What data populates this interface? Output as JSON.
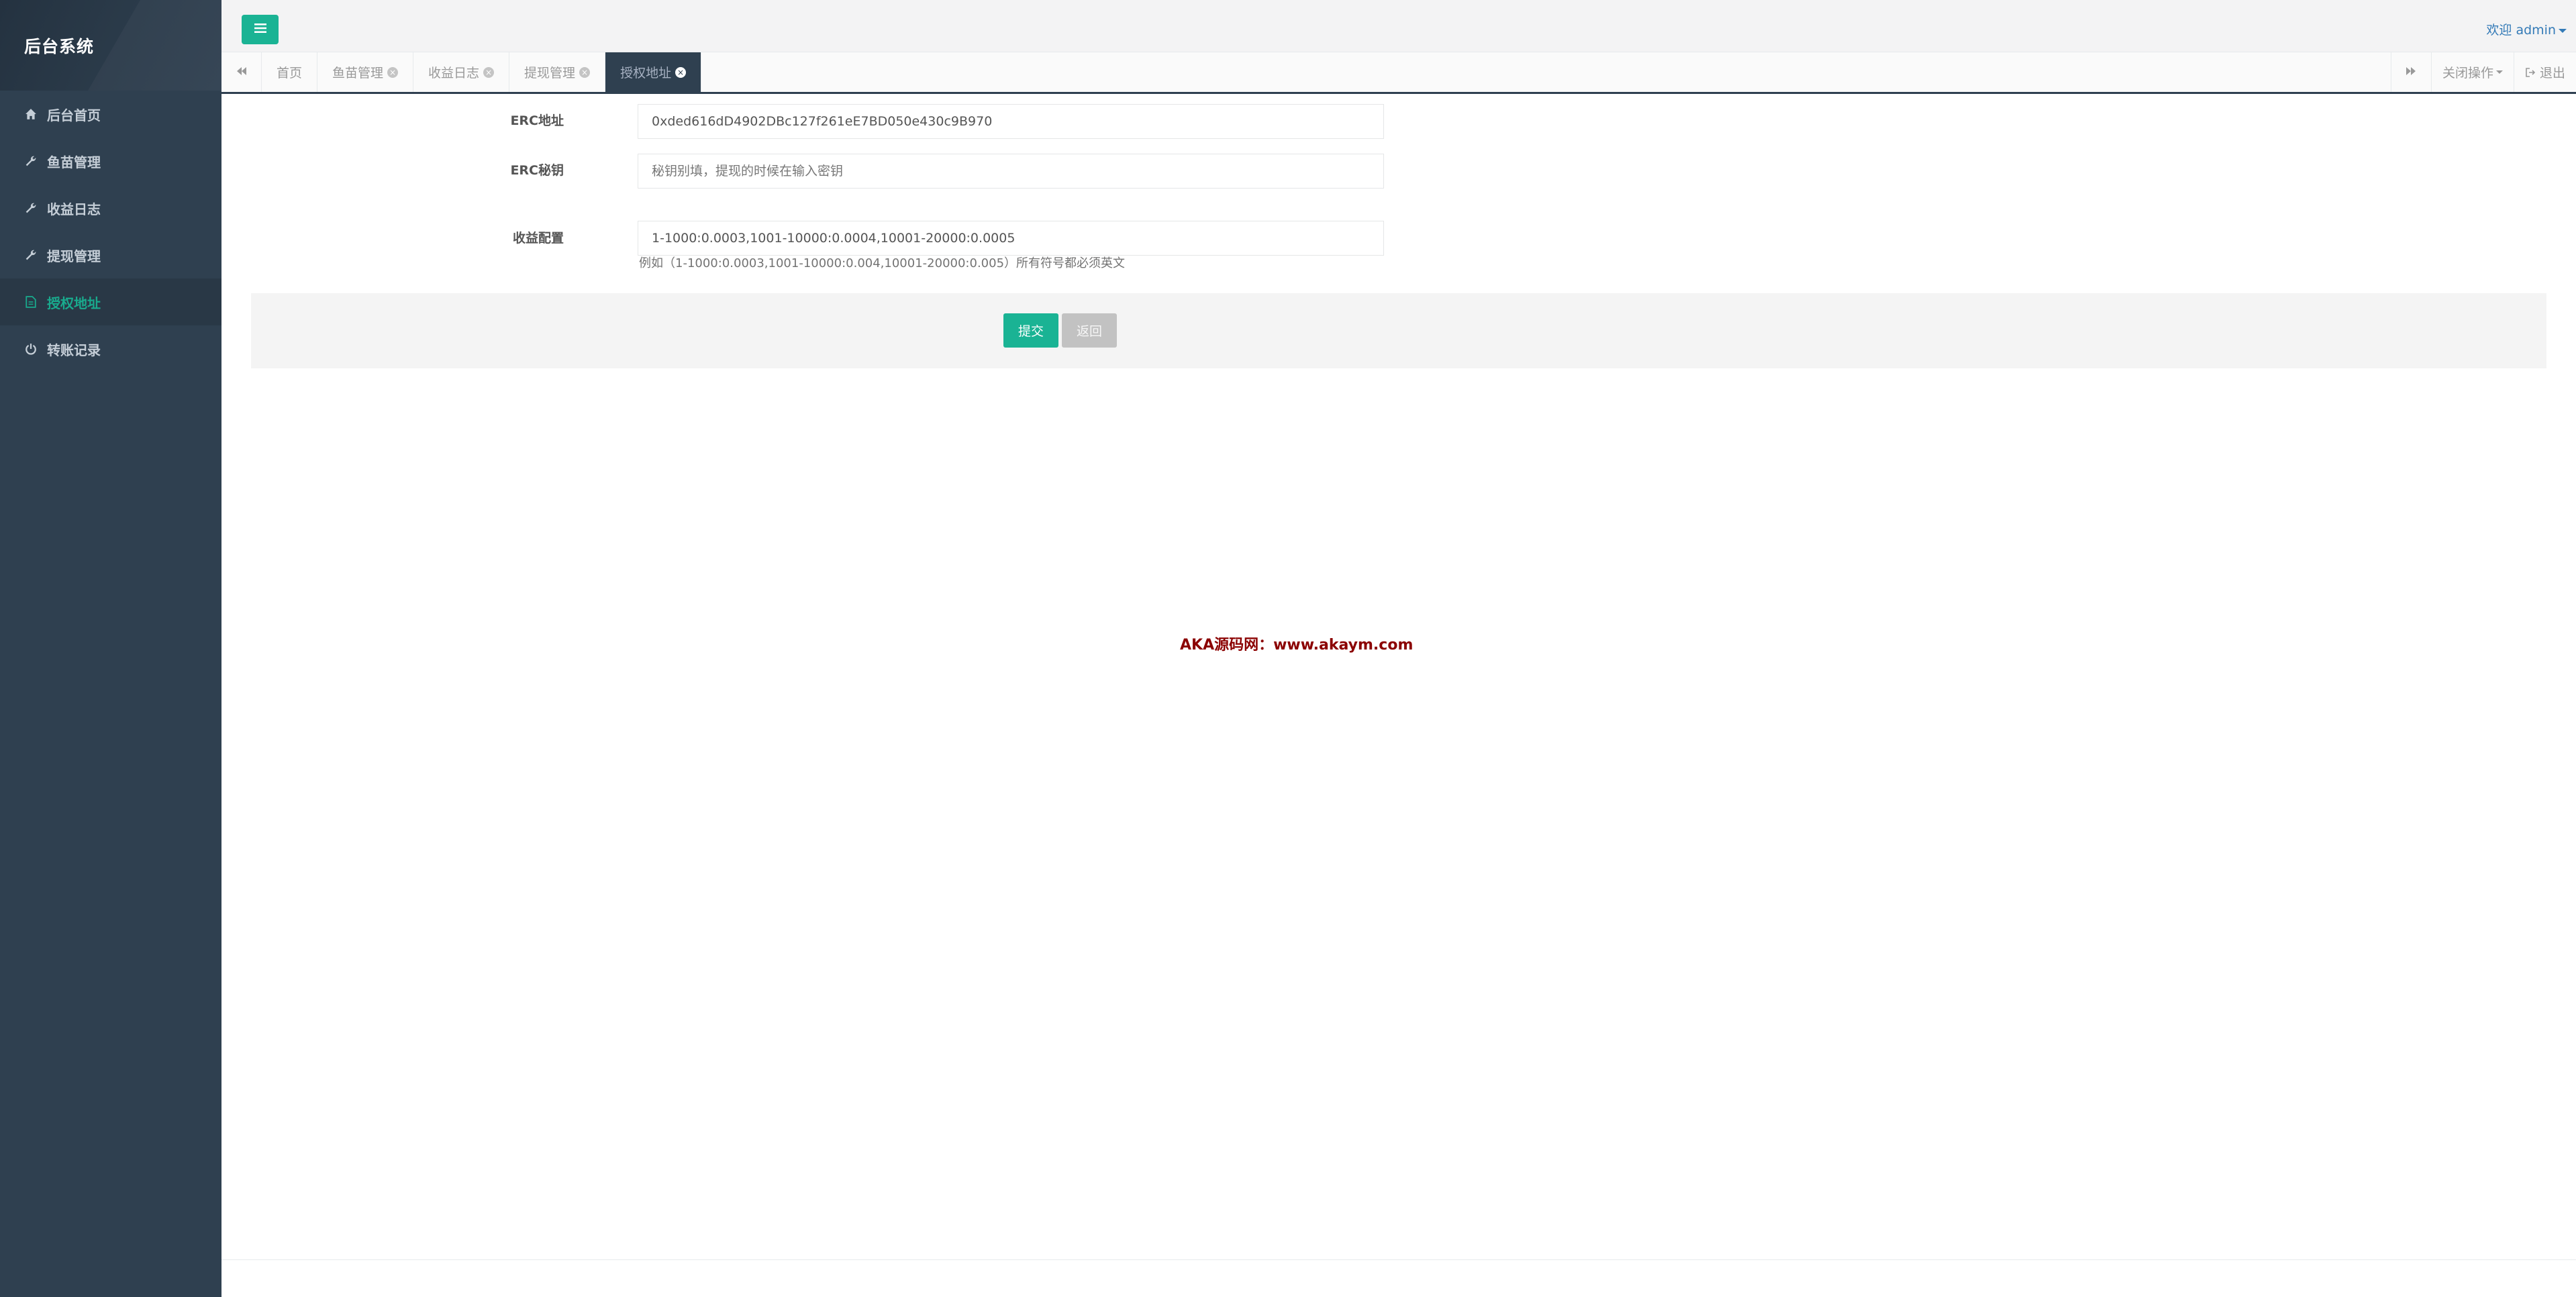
{
  "app": {
    "title": "后台系统"
  },
  "sidebar": {
    "items": [
      {
        "label": "后台首页",
        "icon": "home-icon"
      },
      {
        "label": "鱼苗管理",
        "icon": "wrench-icon"
      },
      {
        "label": "收益日志",
        "icon": "wrench-icon"
      },
      {
        "label": "提现管理",
        "icon": "wrench-icon"
      },
      {
        "label": "授权地址",
        "icon": "file-icon",
        "active": true
      },
      {
        "label": "转账记录",
        "icon": "power-icon"
      }
    ]
  },
  "header": {
    "welcome": "欢迎 admin"
  },
  "tabs": {
    "items": [
      {
        "label": "首页",
        "closable": false
      },
      {
        "label": "鱼苗管理",
        "closable": true
      },
      {
        "label": "收益日志",
        "closable": true
      },
      {
        "label": "提现管理",
        "closable": true
      },
      {
        "label": "授权地址",
        "closable": true,
        "active": true
      }
    ],
    "close_ops": "关闭操作",
    "logout": "退出"
  },
  "form": {
    "erc_address": {
      "label": "ERC地址",
      "value": "0xded616dD4902DBc127f261eE7BD050e430c9B970"
    },
    "erc_secret": {
      "label": "ERC秘钥",
      "placeholder": "秘钥别填，提现的时候在输入密钥",
      "value": ""
    },
    "income_config": {
      "label": "收益配置",
      "value": "1-1000:0.0003,1001-10000:0.0004,10001-20000:0.0005",
      "help": "例如（1-1000:0.0003,1001-10000:0.004,10001-20000:0.005）所有符号都必须英文"
    },
    "submit_label": "提交",
    "back_label": "返回"
  },
  "watermark": "AKA源码网：www.akaym.com",
  "colors": {
    "sidebar_bg": "#2f4050",
    "accent": "#1ab394",
    "active_text": "#19aa8d",
    "link": "#337ab7",
    "watermark": "#8b0000"
  }
}
